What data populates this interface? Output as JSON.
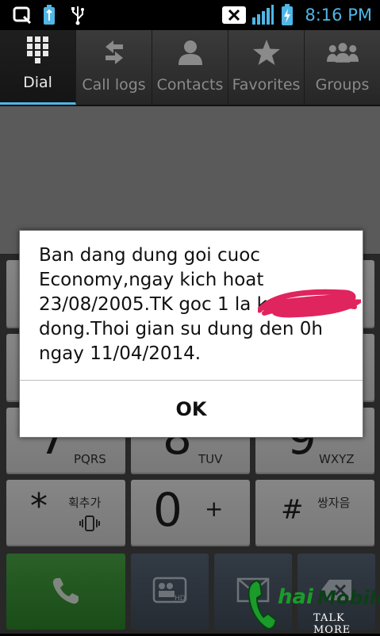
{
  "status_bar": {
    "time": "8:16 PM",
    "accent": "#4fb6e6",
    "icons": [
      "quickmemo-icon",
      "battery-usb-icon",
      "usb-icon",
      "no-sim-icon",
      "signal-icon",
      "battery-icon"
    ]
  },
  "tabs": [
    {
      "label": "Dial",
      "icon": "dialpad-icon",
      "active": true
    },
    {
      "label": "Call logs",
      "icon": "call-logs-icon",
      "active": false
    },
    {
      "label": "Contacts",
      "icon": "person-icon",
      "active": false
    },
    {
      "label": "Favorites",
      "icon": "star-icon",
      "active": false
    },
    {
      "label": "Groups",
      "icon": "groups-icon",
      "active": false
    }
  ],
  "keypad": {
    "key_7": {
      "digit": "7",
      "letters": "PQRS"
    },
    "key_8": {
      "digit": "8",
      "letters": "TUV"
    },
    "key_9": {
      "digit": "9",
      "letters": "WXYZ"
    },
    "key_star": {
      "symbol": "*",
      "label": "획추가"
    },
    "key_0": {
      "digit": "0",
      "symbol": "+"
    },
    "key_hash": {
      "symbol": "#",
      "label": "쌍자음"
    }
  },
  "dialog": {
    "message": "Ban dang dung goi cuoc Economy,ngay kich hoat 23/08/2005.TK goc 1 la        k dong.Thoi gian su dung den 0h ngay 11/04/2014.",
    "ok_label": "OK"
  },
  "watermark": {
    "part1": "hai",
    "part2": "Mobile",
    "tagline": "TALK MORE"
  }
}
